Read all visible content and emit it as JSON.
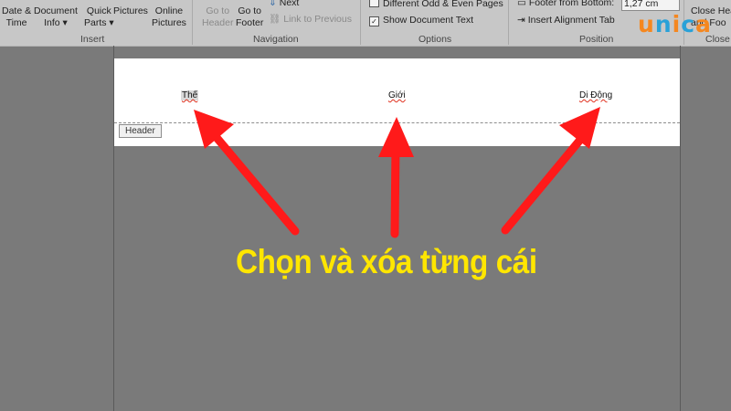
{
  "ribbon": {
    "insert": {
      "date_time": [
        "Date &",
        "Time"
      ],
      "document_info": [
        "Document",
        "Info ▾"
      ],
      "quick_parts": [
        "Quick",
        "Parts ▾"
      ],
      "pictures": [
        "Pictures"
      ],
      "online_pictures": [
        "Online",
        "Pictures"
      ],
      "group_label": "Insert"
    },
    "navigation": {
      "go_to_header": [
        "Go to",
        "Header"
      ],
      "go_to_footer": [
        "Go to",
        "Footer"
      ],
      "next": "Next",
      "link_to_previous": "Link to Previous",
      "group_label": "Navigation"
    },
    "options": {
      "different_odd_even": "Different Odd & Even Pages",
      "show_document_text": "Show Document Text",
      "group_label": "Options"
    },
    "position": {
      "footer_from_bottom": "Footer from Bottom:",
      "footer_value": "1,27 cm",
      "insert_alignment_tab": "Insert Alignment Tab",
      "group_label": "Position"
    },
    "close": {
      "close_header": [
        "Close Hea",
        "and Foo"
      ],
      "group_label": "Close"
    }
  },
  "logo": {
    "text": "unica",
    "primary": "#f5871f",
    "secondary": "#29a1d8"
  },
  "document": {
    "header_texts": [
      "Thế",
      "Giới",
      "Di Động"
    ],
    "header_tab": "Header"
  },
  "caption": "Chọn và xóa từng cái",
  "colors": {
    "arrow": "#ff1a1a",
    "caption": "#ffe600",
    "workspace": "#7a7a7a"
  }
}
